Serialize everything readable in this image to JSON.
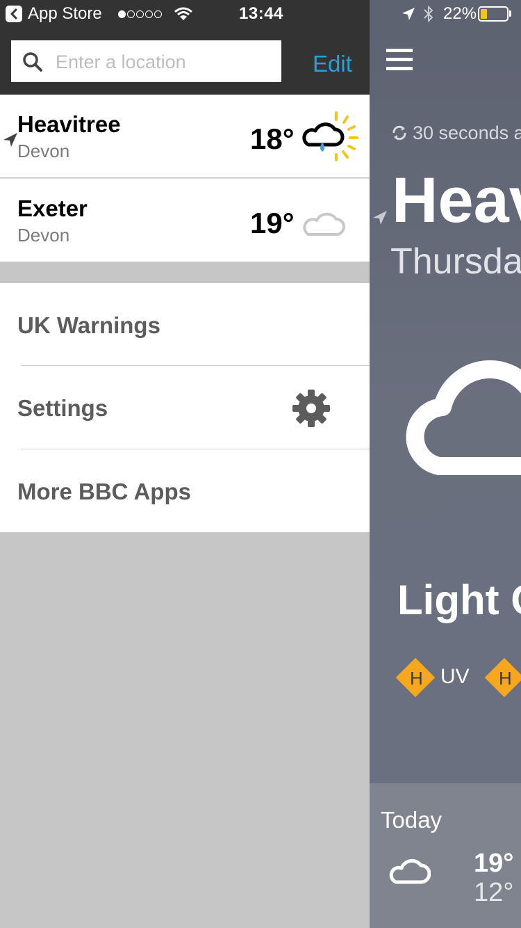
{
  "status_bar": {
    "back_label": "App Store",
    "time": "13:44",
    "battery_percent": "22%",
    "battery_level": 0.22,
    "battery_color": "#f2c618"
  },
  "search": {
    "placeholder": "Enter a location"
  },
  "edit_label": "Edit",
  "accent_color": "#2aa0d6",
  "locations": [
    {
      "name": "Heavitree",
      "region": "Devon",
      "temp": "18°",
      "icon": "sun-cloud-rain-icon",
      "current": true
    },
    {
      "name": "Exeter",
      "region": "Devon",
      "temp": "19°",
      "icon": "cloud-icon",
      "current": false
    }
  ],
  "menu": [
    {
      "label": "UK Warnings"
    },
    {
      "label": "Settings",
      "icon": "gear-icon"
    },
    {
      "label": "More BBC Apps"
    }
  ],
  "main": {
    "updated": "30 seconds a",
    "city": "Heav",
    "day": "Thursda",
    "description": "Light C",
    "badges": [
      {
        "letter": "H"
      },
      {
        "letter": "H"
      }
    ],
    "uv_label": "UV",
    "today": {
      "label": "Today",
      "high": "19°",
      "low": "12°",
      "icon": "cloud-icon"
    }
  }
}
